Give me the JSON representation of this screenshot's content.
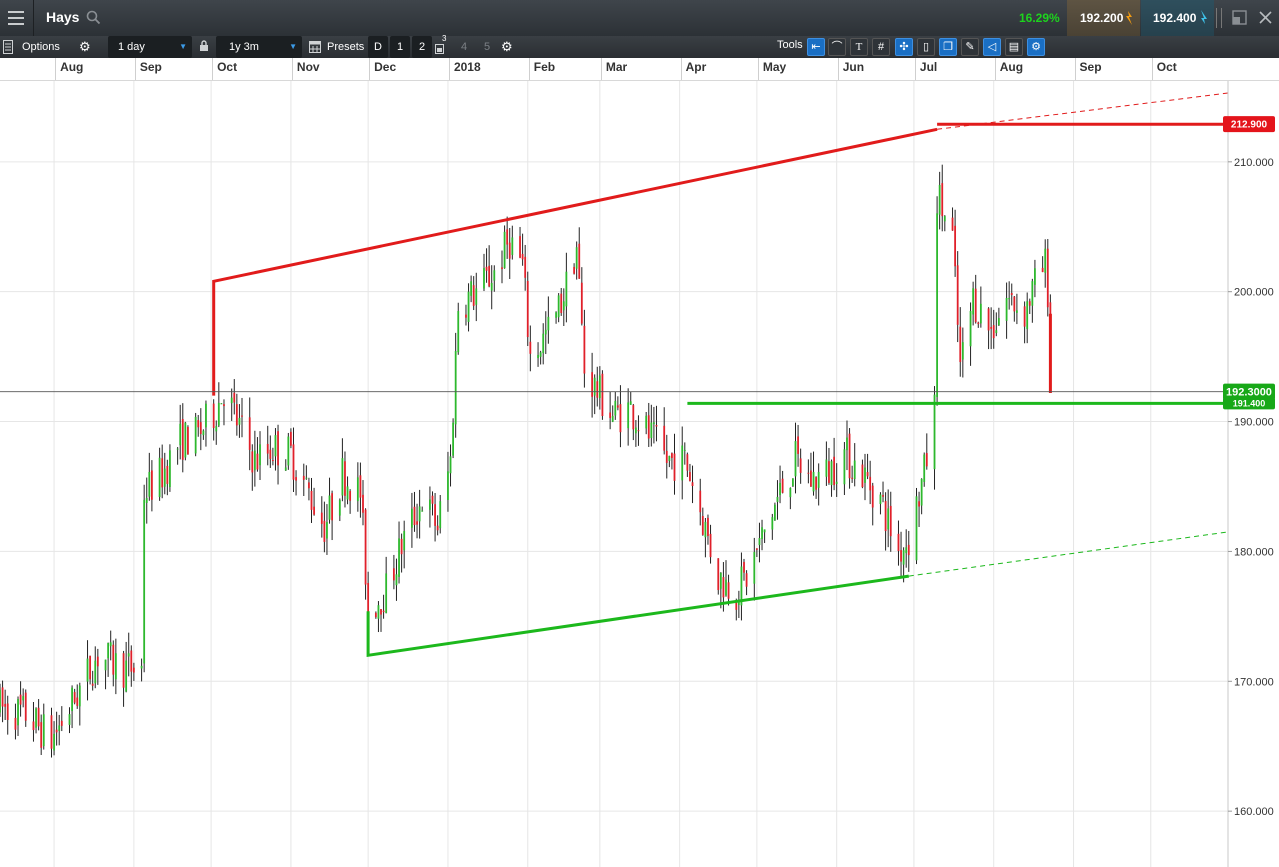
{
  "header": {
    "instrument": "Hays",
    "change_pct": "16.29%",
    "sell_price": "192.200",
    "buy_price": "192.400"
  },
  "toolbar": {
    "options_label": "Options",
    "interval": "1 day",
    "range": "1y 3m",
    "presets_label": "Presets",
    "presets": [
      "D",
      "1",
      "2",
      "3",
      "4",
      "5"
    ],
    "tools_label": "Tools"
  },
  "colors": {
    "up": "#2db82d",
    "down": "#e0202a",
    "trend_red": "#e11b1b",
    "trend_green": "#1cb81c",
    "price_line": "#555555",
    "change_green": "#1dd31d"
  },
  "chart_data": {
    "type": "candlestick",
    "x_range": [
      "2017-07-11",
      "2018-10-31"
    ],
    "y_range": [
      155.7,
      216.3
    ],
    "month_labels": [
      "Aug",
      "Sep",
      "Oct",
      "Nov",
      "Dec",
      "2018",
      "Feb",
      "Mar",
      "Apr",
      "May",
      "Jun",
      "Jul",
      "Aug",
      "Sep",
      "Oct"
    ],
    "y_ticks": [
      160,
      170,
      180,
      190,
      200,
      210
    ],
    "y_tick_labels": [
      "160.000",
      "170.000",
      "180.000",
      "190.000",
      "200.000",
      "210.000"
    ],
    "current_price": 192.3,
    "current_price_label": "192.3000",
    "support_label": "191.400",
    "resistance_label": "212.900",
    "trendlines": [
      {
        "color": "red",
        "points": [
          [
            "2017-10-02",
            192.0
          ],
          [
            "2017-10-02",
            200.8
          ],
          [
            "2018-07-10",
            212.5
          ]
        ]
      },
      {
        "color": "red",
        "points": [
          [
            "2018-07-10",
            212.9
          ],
          [
            "2018-10-31",
            212.9
          ]
        ]
      },
      {
        "color": "red",
        "dashed": true,
        "points": [
          [
            "2018-07-10",
            212.5
          ],
          [
            "2018-10-31",
            215.3
          ]
        ]
      },
      {
        "color": "green",
        "points": [
          [
            "2018-04-04",
            191.4
          ],
          [
            "2018-10-31",
            191.4
          ]
        ]
      },
      {
        "color": "green",
        "points": [
          [
            "2017-12-01",
            175.4
          ],
          [
            "2017-12-01",
            172.0
          ],
          [
            "2018-06-29",
            178.1
          ]
        ]
      },
      {
        "color": "green",
        "dashed": true,
        "points": [
          [
            "2018-06-29",
            178.1
          ],
          [
            "2018-10-31",
            181.5
          ]
        ]
      },
      {
        "color": "red",
        "points": [
          [
            "2018-08-23",
            198.3
          ],
          [
            "2018-08-23",
            192.2
          ]
        ]
      }
    ],
    "anchors": [
      [
        "2017-07-11",
        168.0
      ],
      [
        "2017-07-21",
        167.5
      ],
      [
        "2017-07-31",
        165.5
      ],
      [
        "2017-08-10",
        169.0
      ],
      [
        "2017-08-18",
        172.0
      ],
      [
        "2017-08-28",
        171.0
      ],
      [
        "2017-09-04",
        171.0
      ],
      [
        "2017-09-05",
        184.5
      ],
      [
        "2017-09-12",
        186.0
      ],
      [
        "2017-09-19",
        188.5
      ],
      [
        "2017-09-26",
        189.0
      ],
      [
        "2017-10-03",
        191.0
      ],
      [
        "2017-10-06",
        192.5
      ],
      [
        "2017-10-11",
        190.0
      ],
      [
        "2017-10-18",
        187.0
      ],
      [
        "2017-10-25",
        188.0
      ],
      [
        "2017-11-01",
        187.5
      ],
      [
        "2017-11-08",
        184.5
      ],
      [
        "2017-11-14",
        182.0
      ],
      [
        "2017-11-17",
        183.5
      ],
      [
        "2017-11-21",
        186.0
      ],
      [
        "2017-11-28",
        184.5
      ],
      [
        "2017-12-01",
        175.5
      ],
      [
        "2017-12-08",
        177.0
      ],
      [
        "2017-12-15",
        181.0
      ],
      [
        "2017-12-22",
        184.0
      ],
      [
        "2017-12-28",
        182.0
      ],
      [
        "2018-01-02",
        187.0
      ],
      [
        "2018-01-05",
        199.0
      ],
      [
        "2018-01-12",
        200.0
      ],
      [
        "2018-01-19",
        201.5
      ],
      [
        "2018-01-25",
        204.0
      ],
      [
        "2018-01-30",
        202.0
      ],
      [
        "2018-02-02",
        195.0
      ],
      [
        "2018-02-06",
        196.0
      ],
      [
        "2018-02-12",
        198.0
      ],
      [
        "2018-02-16",
        200.5
      ],
      [
        "2018-02-20",
        203.5
      ],
      [
        "2018-02-23",
        194.0
      ],
      [
        "2018-03-01",
        192.0
      ],
      [
        "2018-03-06",
        190.5
      ],
      [
        "2018-03-13",
        191.0
      ],
      [
        "2018-03-20",
        189.0
      ],
      [
        "2018-03-27",
        187.0
      ],
      [
        "2018-04-03",
        187.0
      ],
      [
        "2018-04-05",
        186.0
      ],
      [
        "2018-04-10",
        182.5
      ],
      [
        "2018-04-16",
        178.0
      ],
      [
        "2018-04-23",
        177.0
      ],
      [
        "2018-04-27",
        178.0
      ],
      [
        "2018-05-03",
        181.0
      ],
      [
        "2018-05-10",
        184.5
      ],
      [
        "2018-05-16",
        187.0
      ],
      [
        "2018-05-22",
        185.5
      ],
      [
        "2018-05-28",
        186.0
      ],
      [
        "2018-06-04",
        187.5
      ],
      [
        "2018-06-11",
        186.0
      ],
      [
        "2018-06-18",
        184.0
      ],
      [
        "2018-06-25",
        180.0
      ],
      [
        "2018-06-29",
        181.0
      ],
      [
        "2018-07-05",
        186.0
      ],
      [
        "2018-07-09",
        191.0
      ],
      [
        "2018-07-10",
        207.5
      ],
      [
        "2018-07-16",
        204.0
      ],
      [
        "2018-07-19",
        194.0
      ],
      [
        "2018-07-24",
        199.5
      ],
      [
        "2018-07-31",
        197.0
      ],
      [
        "2018-08-06",
        199.5
      ],
      [
        "2018-08-13",
        198.5
      ],
      [
        "2018-08-17",
        200.5
      ],
      [
        "2018-08-21",
        202.0
      ],
      [
        "2018-08-23",
        198.5
      ]
    ]
  }
}
